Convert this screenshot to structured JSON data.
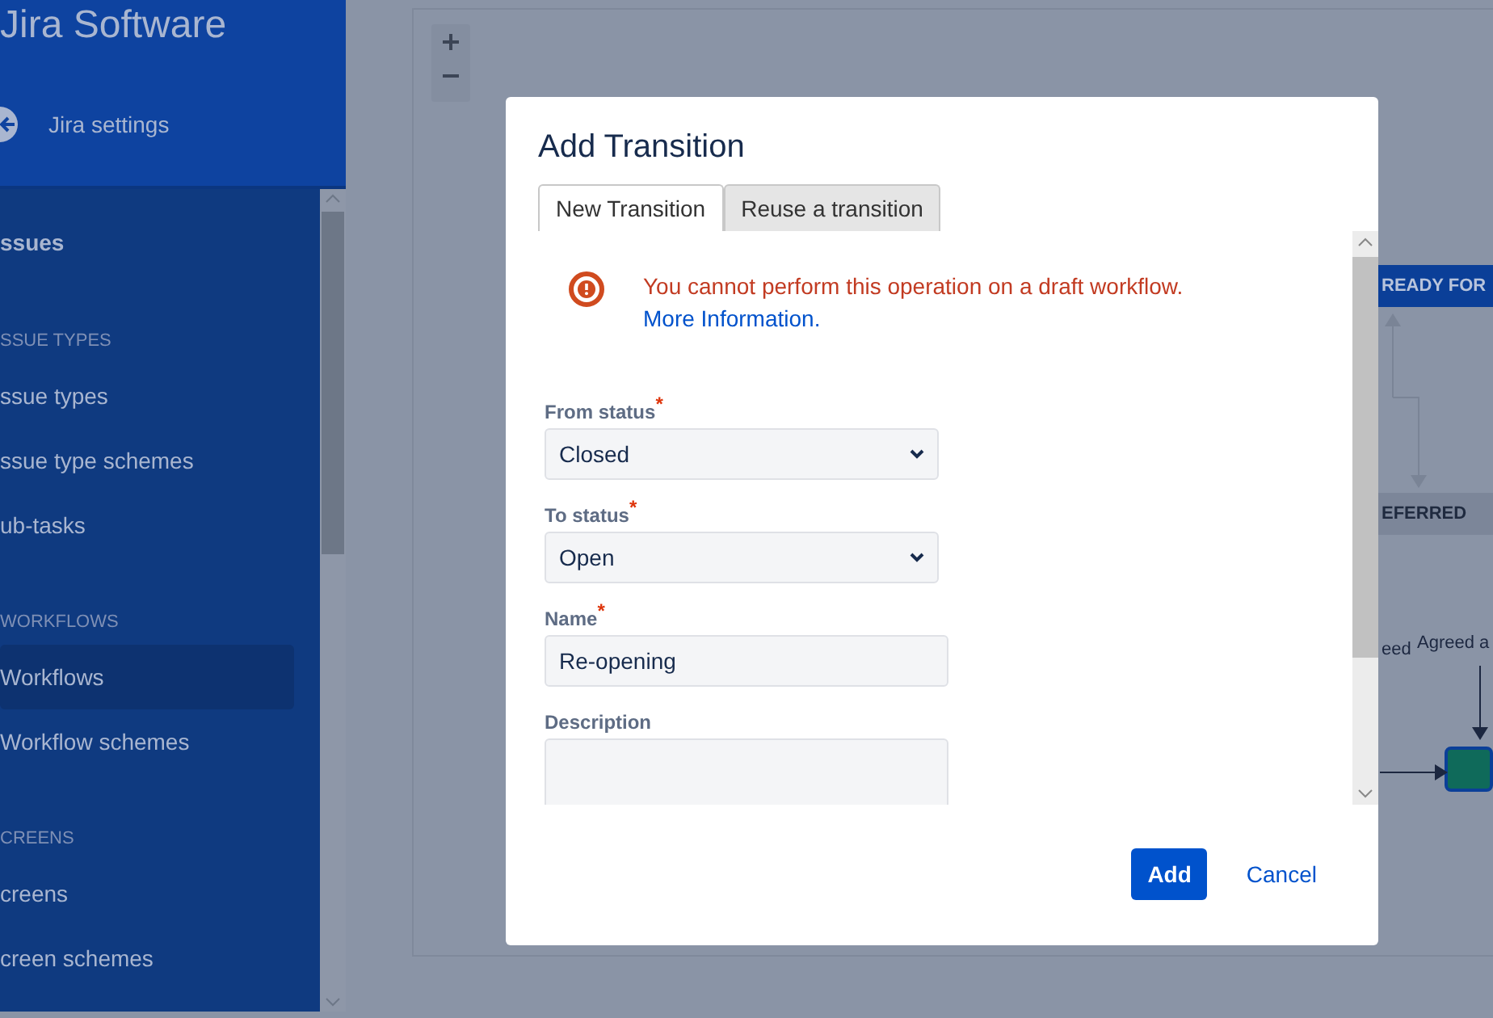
{
  "app": {
    "title": "Jira Software",
    "back_link": "Jira settings"
  },
  "sidebar": {
    "items": [
      {
        "kind": "heading",
        "label": "ssues",
        "selected": false
      },
      {
        "kind": "section",
        "label": "SSUE TYPES",
        "selected": false
      },
      {
        "kind": "link",
        "label": "ssue types",
        "selected": false
      },
      {
        "kind": "link",
        "label": "ssue type schemes",
        "selected": false
      },
      {
        "kind": "link",
        "label": "ub-tasks",
        "selected": false
      },
      {
        "kind": "section",
        "label": "WORKFLOWS",
        "selected": false
      },
      {
        "kind": "link",
        "label": "Workflows",
        "selected": true
      },
      {
        "kind": "link",
        "label": "Workflow schemes",
        "selected": false
      },
      {
        "kind": "section",
        "label": "CREENS",
        "selected": false
      },
      {
        "kind": "link",
        "label": "creens",
        "selected": false
      },
      {
        "kind": "link",
        "label": "creen schemes",
        "selected": false
      }
    ]
  },
  "canvas": {
    "nodes": [
      {
        "kind": "active",
        "label": "READY FOR"
      },
      {
        "kind": "neutral",
        "label": "EFERRED"
      },
      {
        "kind": "done"
      }
    ],
    "transition_labels": [
      "eed",
      "Agreed a"
    ]
  },
  "dialog": {
    "title": "Add Transition",
    "tabs": [
      {
        "label": "New Transition",
        "selected": true
      },
      {
        "label": "Reuse a transition",
        "selected": false
      }
    ],
    "alert": {
      "message": "You cannot perform this operation on a draft workflow.",
      "link": "More Information."
    },
    "fields": [
      {
        "kind": "select",
        "label": "From status",
        "required_mark": "*",
        "value": "Closed"
      },
      {
        "kind": "select",
        "label": "To status",
        "required_mark": "*",
        "value": "Open"
      },
      {
        "kind": "text",
        "label": "Name",
        "required_mark": "*",
        "value": "Re-opening"
      },
      {
        "kind": "textarea",
        "label": "Description"
      }
    ],
    "buttons": [
      {
        "kind": "primary",
        "label": "Add"
      },
      {
        "kind": "link",
        "label": "Cancel"
      }
    ]
  }
}
